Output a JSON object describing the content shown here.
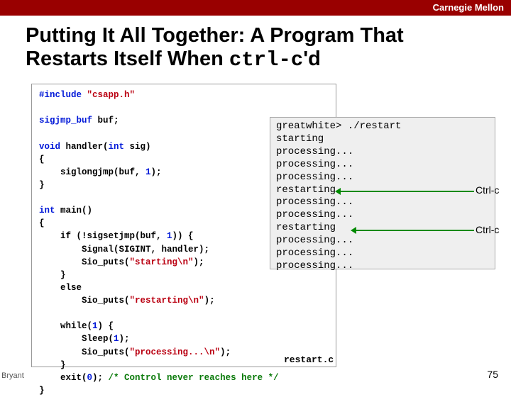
{
  "header": {
    "brand": "Carnegie Mellon"
  },
  "title": {
    "part1": "Putting It All Together: A Program That Restarts Itself When ",
    "mono": "ctrl-c",
    "part2": "'d"
  },
  "code": {
    "l01a": "#include ",
    "l01b": "\"csapp.h\"",
    "l02": "",
    "l03a": "sigjmp_buf",
    "l03b": " buf;",
    "l04": "",
    "l05a": "void",
    "l05b": " handler(",
    "l05c": "int",
    "l05d": " sig)",
    "l06": "{",
    "l07a": "    siglongjmp(buf, ",
    "l07b": "1",
    "l07c": ");",
    "l08": "}",
    "l09": "",
    "l10a": "int",
    "l10b": " main()",
    "l11": "{",
    "l12a": "    if (!sigsetjmp(buf, ",
    "l12b": "1",
    "l12c": ")) {",
    "l13": "        Signal(SIGINT, handler);",
    "l14a": "        Sio_puts(",
    "l14b": "\"starting\\n\"",
    "l14c": ");",
    "l15": "    }",
    "l16": "    else",
    "l17a": "        Sio_puts(",
    "l17b": "\"restarting\\n\"",
    "l17c": ");",
    "l18": "",
    "l19a": "    while(",
    "l19b": "1",
    "l19c": ") {",
    "l20a": "        Sleep(",
    "l20b": "1",
    "l20c": ");",
    "l21a": "        Sio_puts(",
    "l21b": "\"processing...\\n\"",
    "l21c": ");",
    "l22": "    }",
    "l23a": "    exit(",
    "l23b": "0",
    "l23c": "); ",
    "l23d": "/* Control never reaches here */",
    "l24": "}"
  },
  "filelabel": "restart.c",
  "output": {
    "l1": "greatwhite> ./restart",
    "l2": "starting",
    "l3": "processing...",
    "l4": "processing...",
    "l5": "processing...",
    "l6": "restarting",
    "l7": "processing...",
    "l8": "processing...",
    "l9": "restarting",
    "l10": "processing...",
    "l11": "processing...",
    "l12": "processing..."
  },
  "annot": {
    "ctrlc": "Ctrl-c"
  },
  "footer": {
    "left": "Bryant",
    "page": "75"
  }
}
